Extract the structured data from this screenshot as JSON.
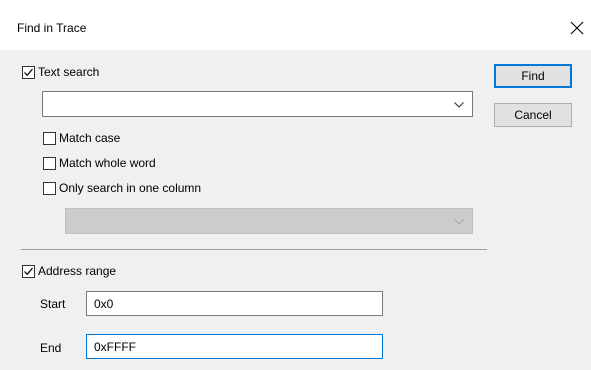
{
  "window": {
    "title": "Find in Trace"
  },
  "text_search": {
    "label": "Text search",
    "checked": true,
    "query_value": "",
    "options": {
      "match_case": {
        "label": "Match case",
        "checked": false
      },
      "match_whole_word": {
        "label": "Match whole word",
        "checked": false
      },
      "one_column": {
        "label": "Only search in one column",
        "checked": false
      }
    },
    "column_value": ""
  },
  "buttons": {
    "find": "Find",
    "cancel": "Cancel"
  },
  "address_range": {
    "label": "Address range",
    "checked": true,
    "start_label": "Start",
    "start_value": "0x0",
    "end_label": "End",
    "end_value": "0xFFFF"
  },
  "icons": {
    "close": "close-icon",
    "check": "check-icon",
    "dropdown": "chevron-down-icon"
  }
}
